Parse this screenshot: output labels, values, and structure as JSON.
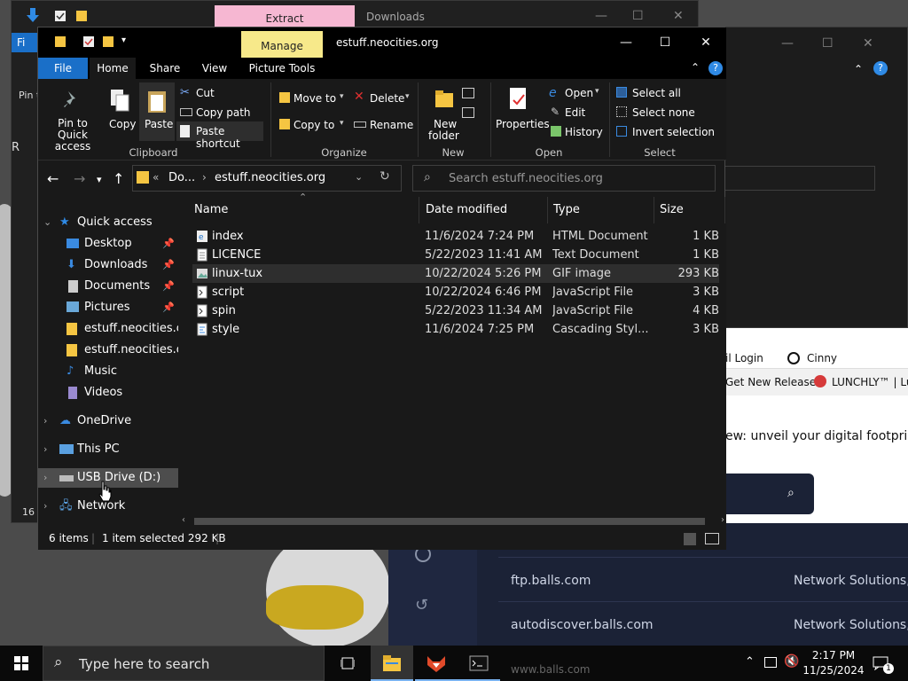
{
  "back_window": {
    "ctx_tab": "Extract",
    "title": "Downloads",
    "file_tab": "Fi",
    "side_text_1": "Pin t",
    "side_text_2": "R",
    "side_text_3": "16"
  },
  "window": {
    "title": "estuff.neocities.org",
    "context_tab": "Manage",
    "context_subtab": "Picture Tools"
  },
  "tabs": [
    "File",
    "Home",
    "Share",
    "View"
  ],
  "ribbon": {
    "pin_label_1": "Pin to Quick",
    "pin_label_2": "access",
    "copy": "Copy",
    "paste": "Paste",
    "cut": "Cut",
    "copy_path": "Copy path",
    "paste_shortcut": "Paste shortcut",
    "move_to": "Move to",
    "copy_to": "Copy to",
    "delete": "Delete",
    "rename": "Rename",
    "new_folder_1": "New",
    "new_folder_2": "folder",
    "properties": "Properties",
    "open": "Open",
    "edit": "Edit",
    "history": "History",
    "select_all": "Select all",
    "select_none": "Select none",
    "invert_selection": "Invert selection",
    "groups": {
      "clipboard": "Clipboard",
      "organize": "Organize",
      "new": "New",
      "open": "Open",
      "select": "Select"
    }
  },
  "address": {
    "crumb_1": "Do...",
    "crumb_2": "estuff.neocities.org",
    "search_placeholder": "Search estuff.neocities.org"
  },
  "nav": {
    "quick_access": "Quick access",
    "desktop": "Desktop",
    "downloads": "Downloads",
    "documents": "Documents",
    "pictures": "Pictures",
    "folder_1": "estuff.neocities.org",
    "folder_2": "estuff.neocities.org",
    "music": "Music",
    "videos": "Videos",
    "onedrive": "OneDrive",
    "this_pc": "This PC",
    "usb": "USB Drive (D:)",
    "network": "Network"
  },
  "columns": {
    "name": "Name",
    "date": "Date modified",
    "type": "Type",
    "size": "Size"
  },
  "files": [
    {
      "name": "index",
      "date": "11/6/2024 7:24 PM",
      "type": "HTML Document",
      "size": "1 KB"
    },
    {
      "name": "LICENCE",
      "date": "5/22/2023 11:41 AM",
      "type": "Text Document",
      "size": "1 KB"
    },
    {
      "name": "linux-tux",
      "date": "10/22/2024 5:26 PM",
      "type": "GIF image",
      "size": "293 KB"
    },
    {
      "name": "script",
      "date": "10/22/2024 6:46 PM",
      "type": "JavaScript File",
      "size": "3 KB"
    },
    {
      "name": "spin",
      "date": "5/22/2023 11:34 AM",
      "type": "JavaScript File",
      "size": "4 KB"
    },
    {
      "name": "style",
      "date": "11/6/2024 7:25 PM",
      "type": "Cascading Styl...",
      "size": "3 KB"
    }
  ],
  "status": {
    "items": "6 items",
    "selected": "1 item selected  292 KB"
  },
  "browser": {
    "bm_1": "il Login",
    "bm_2": "Cinny",
    "bm_3": "Get New Releases",
    "bm_4": "LUNCHLY™ | Lu",
    "banner": "ew: unveil your digital footprint",
    "dash": "-",
    "row_1_host": "ftp.balls.com",
    "row_1_reg": "Network Solutions, L",
    "row_2_host": "autodiscover.balls.com",
    "row_2_reg": "Network Solutions, L",
    "row_3_host": "www.balls.com"
  },
  "taskbar": {
    "search_placeholder": "Type here to search",
    "time": "2:17 PM",
    "date": "11/25/2024",
    "notif_count": "1"
  },
  "colors": {
    "accent": "#1a6fc8",
    "manage_tab": "#f7e98a",
    "extract_tab": "#f6b7d2",
    "folder": "#f5c542"
  }
}
